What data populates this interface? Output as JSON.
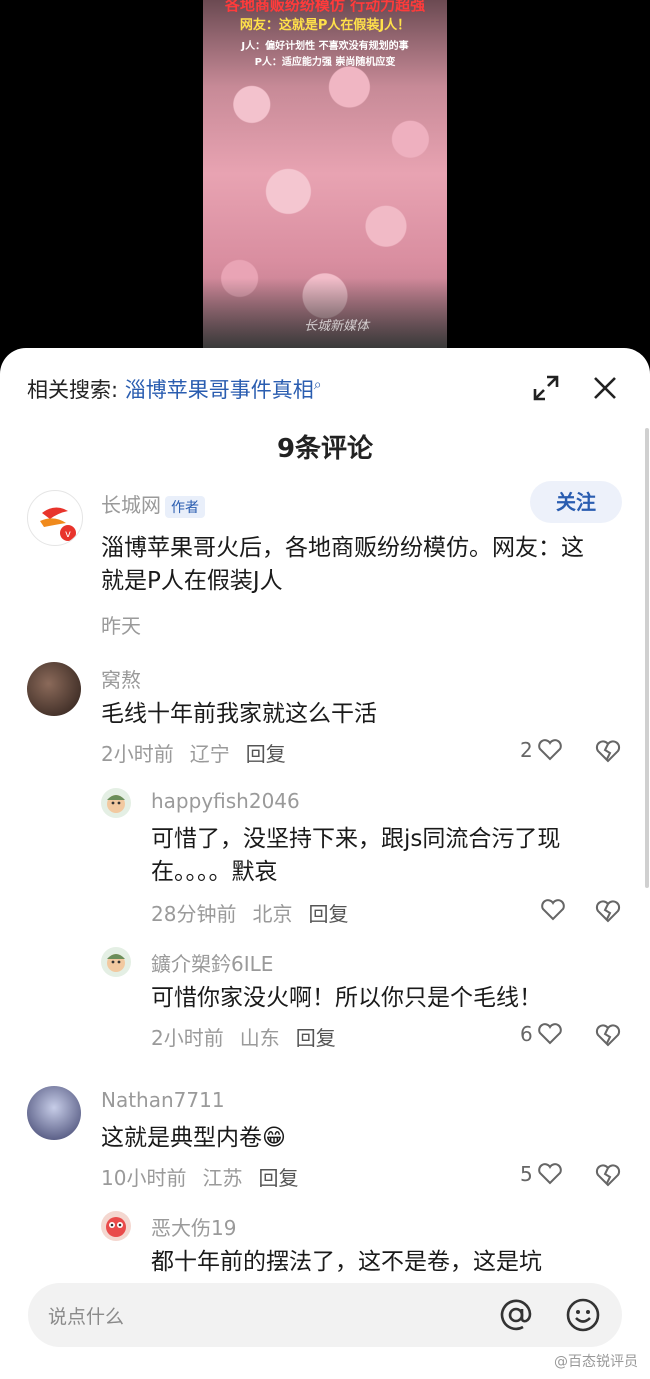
{
  "video": {
    "caption_line1": "各地商贩纷纷模仿 行动力超强",
    "caption_line2": "网友：这就是P人在假装J人！",
    "caption_line3": "J人：偏好计划性 不喜欢没有规划的事",
    "caption_line4": "P人：适应能力强 崇尚随机应变",
    "watermark": "长城新媒体"
  },
  "related_search": {
    "label": "相关搜索:",
    "query": "淄博苹果哥事件真相"
  },
  "comment_count": "9条评论",
  "author_post": {
    "name": "长城网",
    "tag": "作者",
    "follow_label": "关注",
    "text": "淄博苹果哥火后，各地商贩纷纷模仿。网友：这就是P人在假装J人",
    "time": "昨天"
  },
  "comments": [
    {
      "name": "窝熬",
      "text": "毛线十年前我家就这么干活",
      "time": "2小时前",
      "location": "辽宁",
      "reply": "回复",
      "likes": "2"
    },
    {
      "name": "happyfish2046",
      "text": "可惜了，没坚持下来，跟js同流合污了现在。。。。默哀",
      "time": "28分钟前",
      "location": "北京",
      "reply": "回复",
      "likes": ""
    },
    {
      "name": "鑛介槊鈐6ILE",
      "text": "可惜你家没火啊！所以你只是个毛线！",
      "time": "2小时前",
      "location": "山东",
      "reply": "回复",
      "likes": "6"
    },
    {
      "name": "Nathan7711",
      "text": "这就是典型内卷😁",
      "time": "10小时前",
      "location": "江苏",
      "reply": "回复",
      "likes": "5"
    },
    {
      "name": "恶大伤19",
      "text": "都十年前的摆法了，这不是卷，这是坑"
    }
  ],
  "input": {
    "placeholder": "说点什么"
  },
  "credit": "@百态锐评员",
  "colors": {
    "accent": "#2a5db0",
    "follow_bg": "#edf1fa"
  }
}
